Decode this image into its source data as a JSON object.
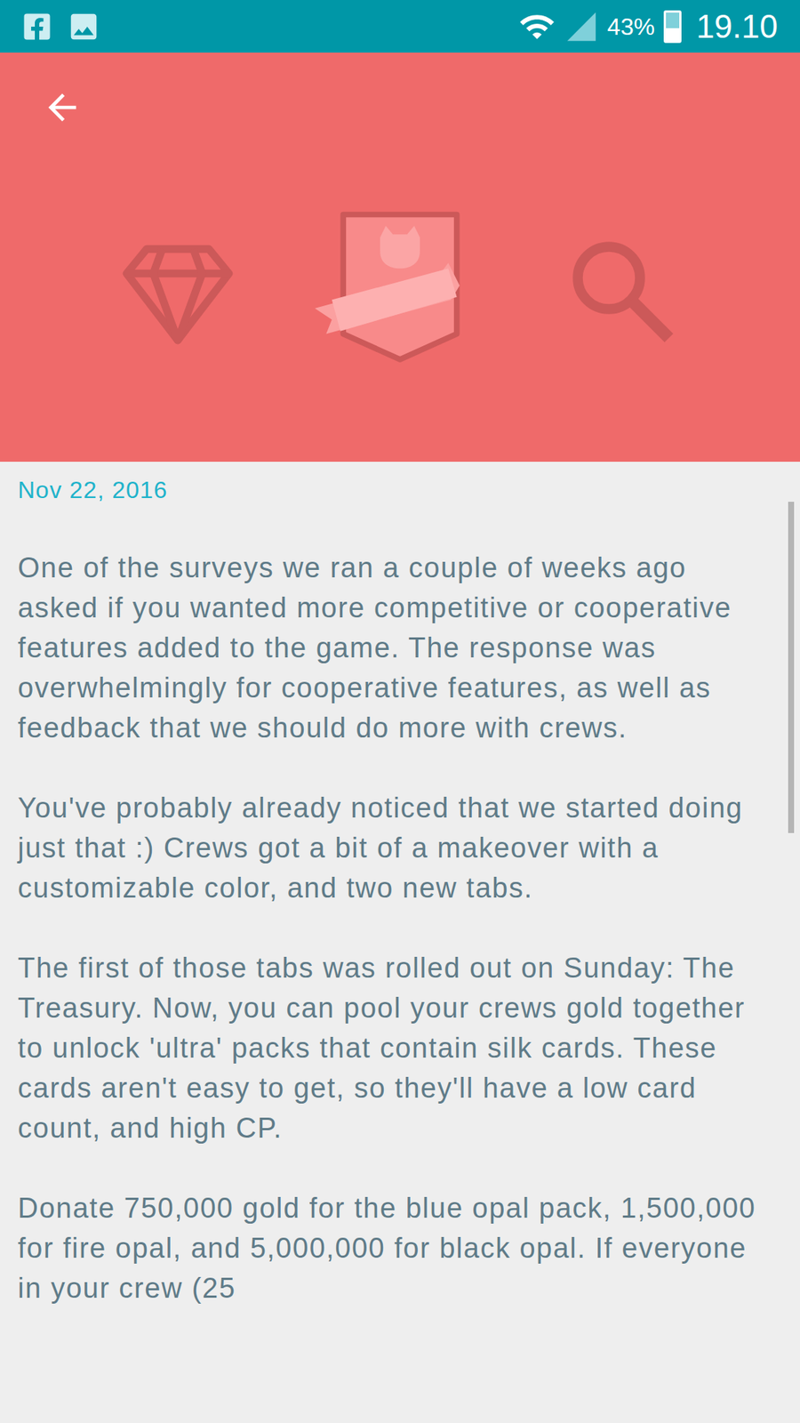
{
  "status_bar": {
    "battery": "43%",
    "battery_level": 0.43,
    "time": "19.10"
  },
  "article": {
    "date": "Nov 22, 2016",
    "paragraphs": [
      "One of the surveys we ran a couple of weeks ago asked if you wanted more competitive or cooperative features added to the game. The response was overwhelmingly for cooperative features, as well as feedback that we should do more with crews.",
      "You've probably already noticed that we started doing just that :) Crews got a bit of a makeover with a customizable color, and two new tabs.",
      "The first of those tabs was rolled out on Sunday: The Treasury. Now, you can pool your crews gold together to unlock 'ultra' packs that contain silk cards. These cards aren't easy to get, so they'll have a low card count, and high CP.",
      "Donate 750,000 gold for the blue opal pack, 1,500,000 for fire opal, and 5,000,000 for black opal. If everyone in your crew (25"
    ]
  },
  "scrollbar": {
    "level": 0.36
  }
}
